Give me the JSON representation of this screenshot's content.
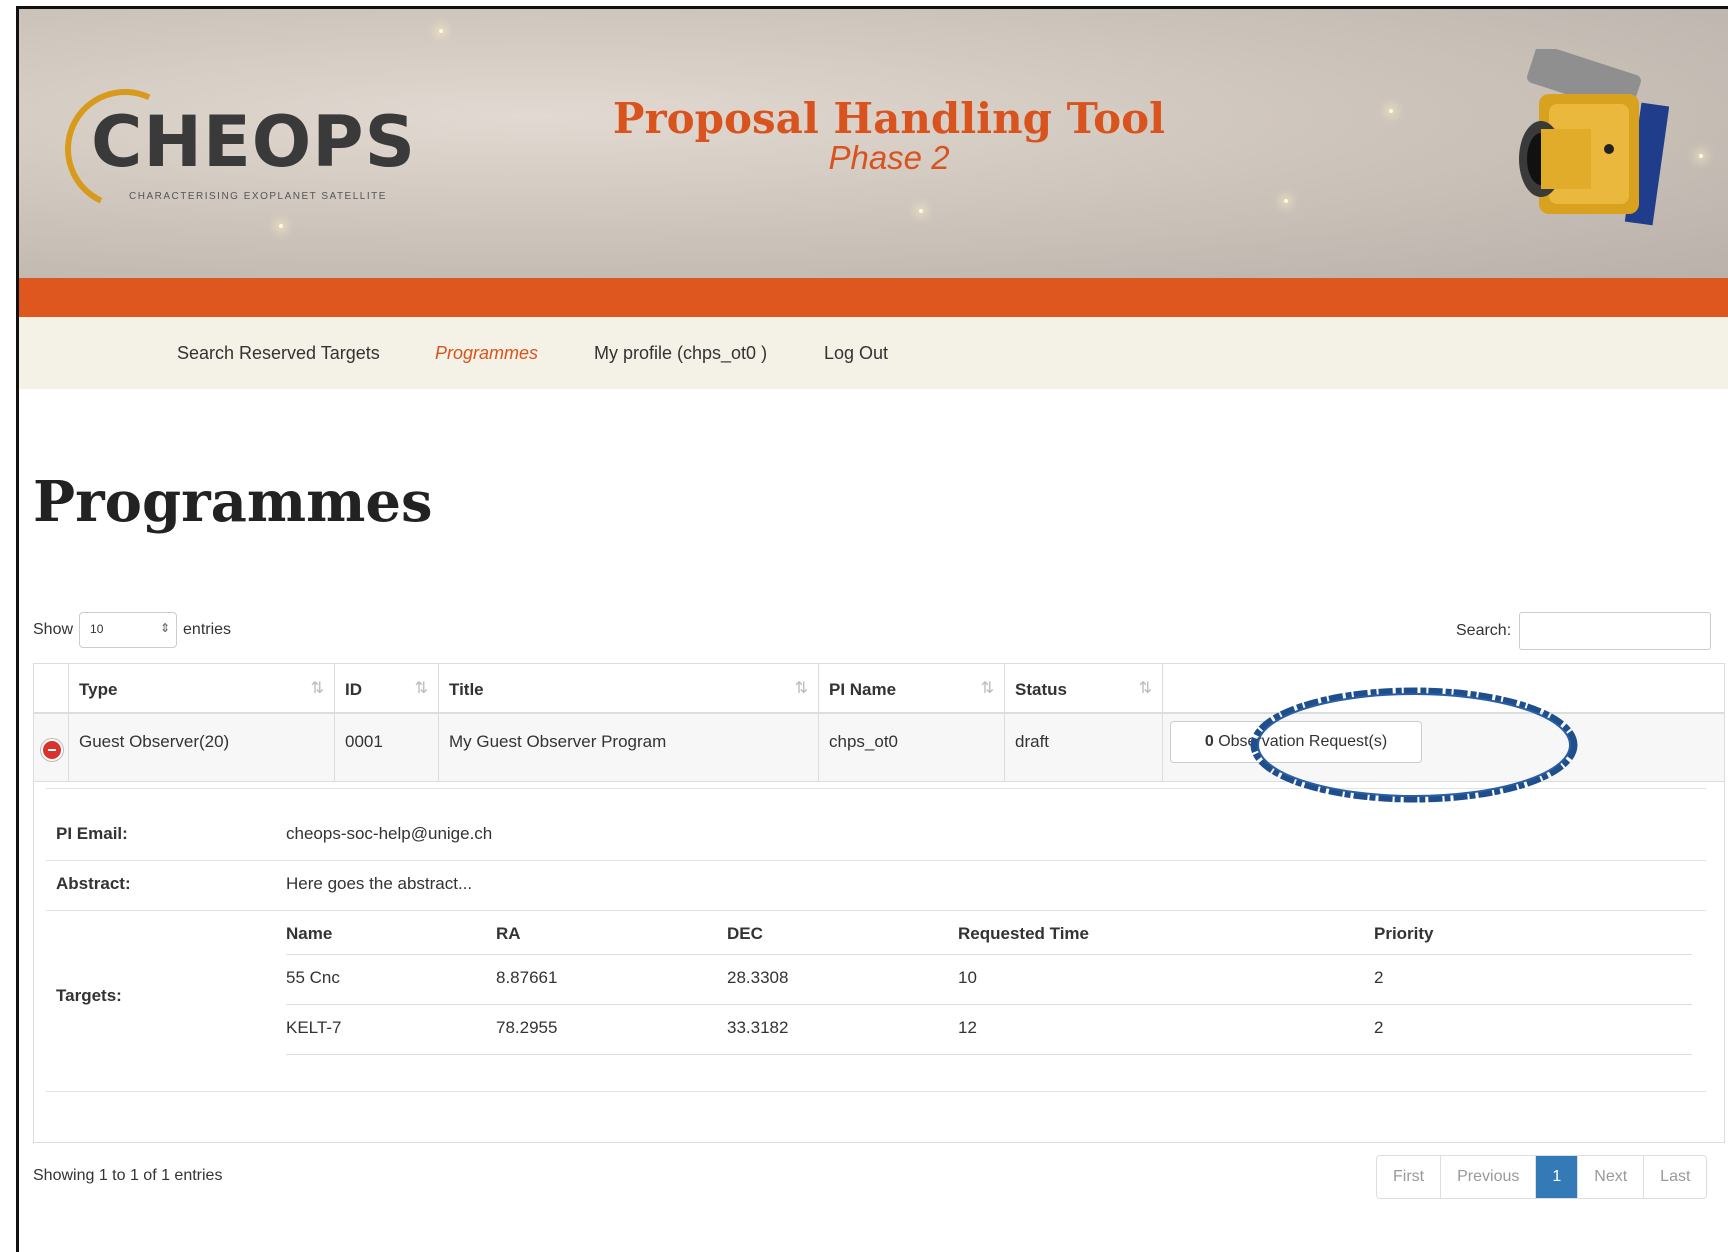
{
  "header": {
    "logo_text": "CHEOPS",
    "logo_subtitle": "CHARACTERISING EXOPLANET SATELLITE",
    "title": "Proposal Handling Tool",
    "subtitle": "Phase 2"
  },
  "colors": {
    "accent": "#dd571e",
    "nav_bg": "#f4f1e6",
    "pager_active": "#337ab7",
    "annotation": "#1f4e8c"
  },
  "nav": {
    "items": [
      {
        "label": "Search Reserved Targets"
      },
      {
        "label": "Programmes",
        "active": true
      },
      {
        "label": "My profile (chps_ot0 )"
      },
      {
        "label": "Log Out"
      }
    ]
  },
  "page_title": "Programmes",
  "length_menu": {
    "prefix": "Show",
    "value": "10",
    "suffix": "entries"
  },
  "search": {
    "label": "Search:",
    "value": ""
  },
  "table": {
    "columns": [
      "Type",
      "ID",
      "Title",
      "PI Name",
      "Status"
    ],
    "row": {
      "type": "Guest Observer(20)",
      "id": "0001",
      "title": "My Guest Observer Program",
      "pi_name": "chps_ot0",
      "status": "draft",
      "obs_count": "0",
      "obs_label": "Observation Request(s)"
    },
    "details": {
      "email_label": "PI Email:",
      "email": "cheops-soc-help@unige.ch",
      "abstract_label": "Abstract:",
      "abstract": "Here goes the abstract...",
      "targets_label": "Targets:",
      "target_columns": [
        "Name",
        "RA",
        "DEC",
        "Requested Time",
        "Priority"
      ],
      "targets": [
        {
          "name": "55 Cnc",
          "ra": "8.87661",
          "dec": "28.3308",
          "time": "10",
          "priority": "2"
        },
        {
          "name": "KELT-7",
          "ra": "78.2955",
          "dec": "33.3182",
          "time": "12",
          "priority": "2"
        }
      ]
    }
  },
  "footer": {
    "info": "Showing 1 to 1 of 1 entries",
    "pager": {
      "first": "First",
      "previous": "Previous",
      "current": "1",
      "next": "Next",
      "last": "Last"
    }
  }
}
